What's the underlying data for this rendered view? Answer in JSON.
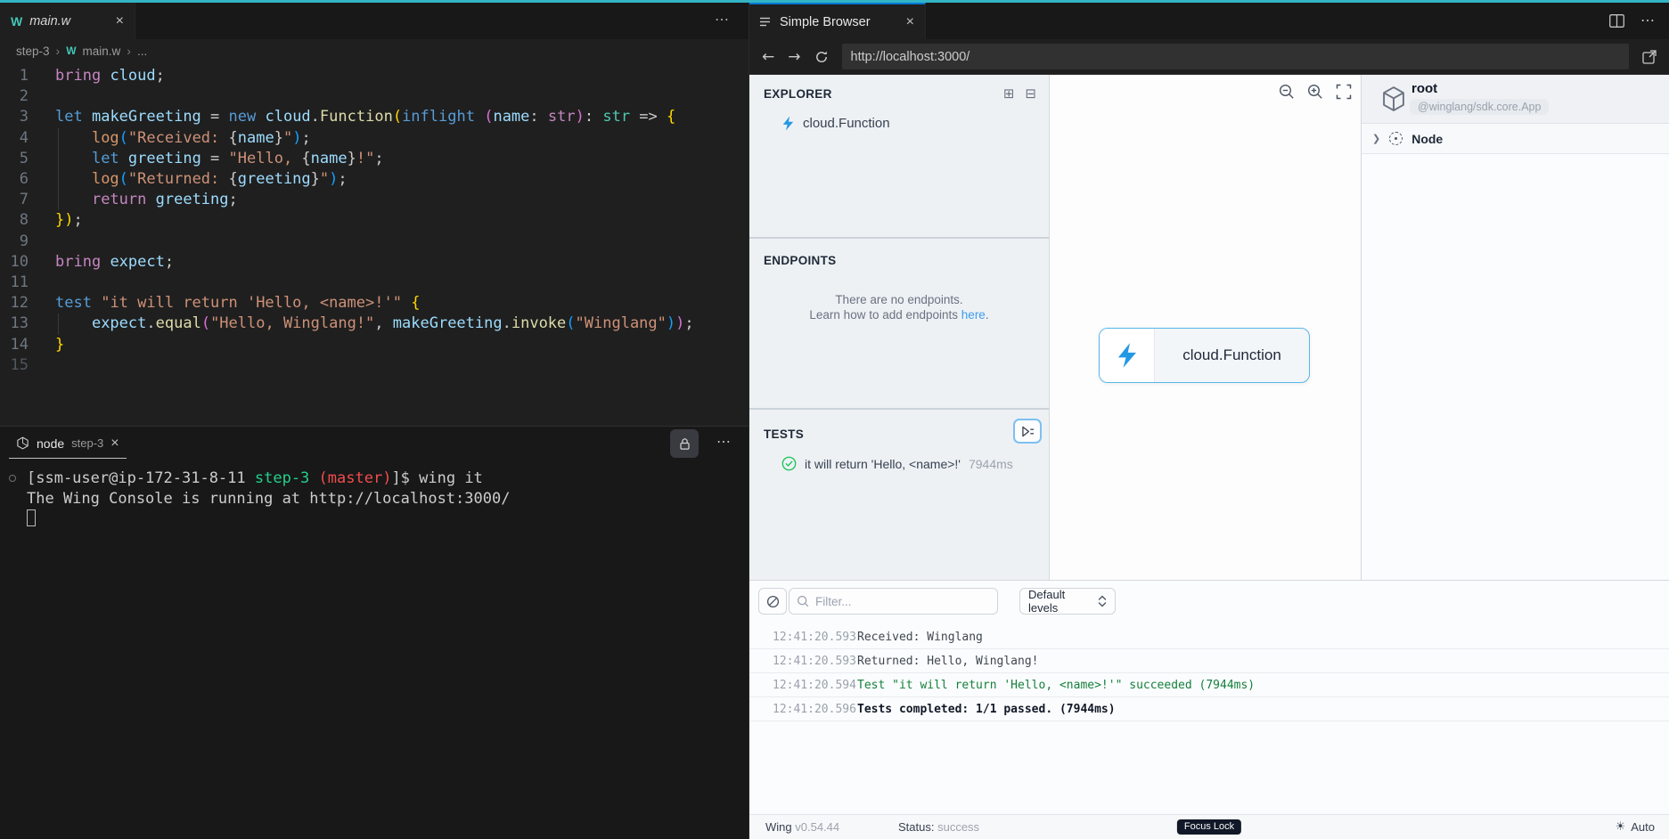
{
  "colors": {
    "window_top_stripe": "#33b5c5",
    "active_tab_accent": "#0078d4",
    "wing_teal": "#43c6b7",
    "bolt_blue": "#2499e3",
    "link_blue": "#3d9bf0",
    "test_pass_green": "#22c55e",
    "log_success_green": "#15803d"
  },
  "editor": {
    "tab": {
      "label": "main.w",
      "close": "×"
    },
    "tabbar_more": "⋯",
    "breadcrumb": {
      "root": "step-3",
      "file": "main.w",
      "more": "...",
      "separator": "›",
      "logo": "W"
    },
    "code": {
      "syntax": {
        "kw": "#569CD6",
        "ctl": "#C586C0",
        "var": "#9CDCFE",
        "fn": "#DCDCAA",
        "str": "#CE9178",
        "type": "#4EC9B0",
        "b1": "#FFD700",
        "b2": "#DA70D6",
        "b3": "#179FFF",
        "def": "#CCCCCC",
        "log": "#D7966A"
      },
      "lines": [
        {
          "n": 1,
          "t": [
            [
              "bring",
              "ctl"
            ],
            [
              " ",
              "def"
            ],
            [
              "cloud",
              "var"
            ],
            [
              ";",
              "def"
            ]
          ]
        },
        {
          "n": 2,
          "t": []
        },
        {
          "n": 3,
          "t": [
            [
              "let",
              "kw"
            ],
            [
              " ",
              "def"
            ],
            [
              "makeGreeting",
              "var"
            ],
            [
              " = ",
              "def"
            ],
            [
              "new",
              "kw"
            ],
            [
              " ",
              "def"
            ],
            [
              "cloud",
              "var"
            ],
            [
              ".",
              "def"
            ],
            [
              "Function",
              "fn"
            ],
            [
              "(",
              "b1"
            ],
            [
              "inflight",
              "kw"
            ],
            [
              " ",
              "def"
            ],
            [
              "(",
              "b2"
            ],
            [
              "name",
              "var"
            ],
            [
              ": ",
              "def"
            ],
            [
              "str",
              "ctl"
            ],
            [
              ")",
              "b2"
            ],
            [
              ": ",
              "def"
            ],
            [
              "str",
              "type"
            ],
            [
              " => ",
              "def"
            ],
            [
              "{",
              "b1"
            ]
          ]
        },
        {
          "n": 4,
          "g": 1,
          "t": [
            [
              "    ",
              "def"
            ],
            [
              "log",
              "log"
            ],
            [
              "(",
              "b3"
            ],
            [
              "\"Received: ",
              "str"
            ],
            [
              "{",
              "def"
            ],
            [
              "name",
              "var"
            ],
            [
              "}",
              "def"
            ],
            [
              "\"",
              "str"
            ],
            [
              ")",
              "b3"
            ],
            [
              ";",
              "def"
            ]
          ]
        },
        {
          "n": 5,
          "g": 1,
          "t": [
            [
              "    ",
              "def"
            ],
            [
              "let",
              "kw"
            ],
            [
              " ",
              "def"
            ],
            [
              "greeting",
              "var"
            ],
            [
              " = ",
              "def"
            ],
            [
              "\"Hello, ",
              "str"
            ],
            [
              "{",
              "def"
            ],
            [
              "name",
              "var"
            ],
            [
              "}",
              "def"
            ],
            [
              "!\"",
              "str"
            ],
            [
              ";",
              "def"
            ]
          ]
        },
        {
          "n": 6,
          "g": 1,
          "t": [
            [
              "    ",
              "def"
            ],
            [
              "log",
              "log"
            ],
            [
              "(",
              "b3"
            ],
            [
              "\"Returned: ",
              "str"
            ],
            [
              "{",
              "def"
            ],
            [
              "greeting",
              "var"
            ],
            [
              "}",
              "def"
            ],
            [
              "\"",
              "str"
            ],
            [
              ")",
              "b3"
            ],
            [
              ";",
              "def"
            ]
          ]
        },
        {
          "n": 7,
          "g": 1,
          "t": [
            [
              "    ",
              "def"
            ],
            [
              "return",
              "ctl"
            ],
            [
              " ",
              "def"
            ],
            [
              "greeting",
              "var"
            ],
            [
              ";",
              "def"
            ]
          ]
        },
        {
          "n": 8,
          "t": [
            [
              "}",
              "b1"
            ],
            [
              ")",
              "b1"
            ],
            [
              ";",
              "def"
            ]
          ]
        },
        {
          "n": 9,
          "t": []
        },
        {
          "n": 10,
          "t": [
            [
              "bring",
              "ctl"
            ],
            [
              " ",
              "def"
            ],
            [
              "expect",
              "var"
            ],
            [
              ";",
              "def"
            ]
          ]
        },
        {
          "n": 11,
          "t": []
        },
        {
          "n": 12,
          "t": [
            [
              "test",
              "kw"
            ],
            [
              " ",
              "def"
            ],
            [
              "\"it will return 'Hello, <name>!'\"",
              "str"
            ],
            [
              " ",
              "def"
            ],
            [
              "{",
              "b1"
            ]
          ]
        },
        {
          "n": 13,
          "g": 1,
          "t": [
            [
              "    ",
              "def"
            ],
            [
              "expect",
              "var"
            ],
            [
              ".",
              "def"
            ],
            [
              "equal",
              "fn"
            ],
            [
              "(",
              "b2"
            ],
            [
              "\"Hello, Winglang!\"",
              "str"
            ],
            [
              ", ",
              "def"
            ],
            [
              "makeGreeting",
              "var"
            ],
            [
              ".",
              "def"
            ],
            [
              "invoke",
              "fn"
            ],
            [
              "(",
              "b3"
            ],
            [
              "\"Winglang\"",
              "str"
            ],
            [
              ")",
              "b3"
            ],
            [
              ")",
              "b2"
            ],
            [
              ";",
              "def"
            ]
          ]
        },
        {
          "n": 14,
          "t": [
            [
              "}",
              "b1"
            ]
          ]
        },
        {
          "n": 15,
          "t": []
        }
      ]
    }
  },
  "terminal": {
    "tab": {
      "name": "node",
      "detail": "step-3",
      "close": "×"
    },
    "more": "⋯",
    "colors": {
      "fg": "#cccccc",
      "green": "#23d18b",
      "red": "#f14c4c"
    },
    "lines": [
      {
        "dot": 1,
        "t": [
          [
            "[ssm-user@ip-172-31-8-11 ",
            "fg"
          ],
          [
            "step-3",
            "green"
          ],
          [
            " ",
            "fg"
          ],
          [
            "(master)",
            "red"
          ],
          [
            "]$ wing it",
            "fg"
          ]
        ]
      },
      {
        "t": [
          [
            "The Wing Console is running at http://localhost:3000/",
            "fg"
          ]
        ]
      },
      {
        "cursor": 1,
        "t": []
      }
    ]
  },
  "browser": {
    "tab": {
      "label": "Simple Browser",
      "close": "×"
    },
    "url": "http://localhost:3000/"
  },
  "console": {
    "explorer": {
      "title": "EXPLORER",
      "item": "cloud.Function"
    },
    "endpoints": {
      "title": "ENDPOINTS",
      "line1": "There are no endpoints.",
      "line2_prefix": "Learn how to add endpoints ",
      "link": "here",
      "suffix": "."
    },
    "tests": {
      "title": "TESTS",
      "item": "it will return 'Hello, <name>!'",
      "duration": "7944ms"
    },
    "canvas": {
      "node_label": "cloud.Function"
    },
    "inspector": {
      "title": "root",
      "subtitle": "@winglang/sdk.core.App",
      "section": "Node"
    },
    "logs": {
      "filter_placeholder": "Filter...",
      "levels": "Default levels",
      "entries": [
        {
          "time": "12:41:20.593",
          "msg": "Received: Winglang",
          "level": "default"
        },
        {
          "time": "12:41:20.593",
          "msg": "Returned: Hello, Winglang!",
          "level": "default"
        },
        {
          "time": "12:41:20.594",
          "msg": "Test \"it will return 'Hello, <name>!'\" succeeded (7944ms)",
          "level": "success"
        },
        {
          "time": "12:41:20.596",
          "msg": "Tests completed: 1/1 passed. (7944ms)",
          "level": "bold"
        }
      ]
    },
    "statusbar": {
      "app": "Wing",
      "version": "v0.54.44",
      "status_label": "Status:",
      "status_value": "success",
      "focus": "Focus Lock",
      "theme": "Auto"
    }
  }
}
